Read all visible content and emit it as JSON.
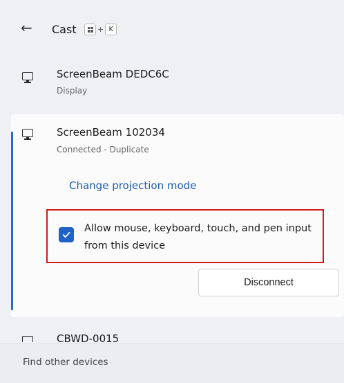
{
  "header": {
    "title": "Cast",
    "shortcut_key": "K",
    "shortcut_plus": "+",
    "back_icon": "back-arrow-icon"
  },
  "devices": [
    {
      "name": "ScreenBeam DEDC6C",
      "subtitle": "Display",
      "icon": "monitor-icon"
    },
    {
      "name": "ScreenBeam 102034",
      "subtitle": "Connected - Duplicate",
      "icon": "monitor-icon"
    },
    {
      "name": "CBWD-0015",
      "icon": "monitor-icon"
    }
  ],
  "expanded": {
    "change_mode_label": "Change projection mode",
    "allow_input_label": "Allow mouse, keyboard, touch, and pen input from this device",
    "allow_input_checked": true,
    "disconnect_label": "Disconnect"
  },
  "footer": {
    "find_label": "Find other devices"
  },
  "colors": {
    "accent": "#1f62c8",
    "link": "#1d5bb8",
    "highlight_border": "#d11b1b"
  }
}
